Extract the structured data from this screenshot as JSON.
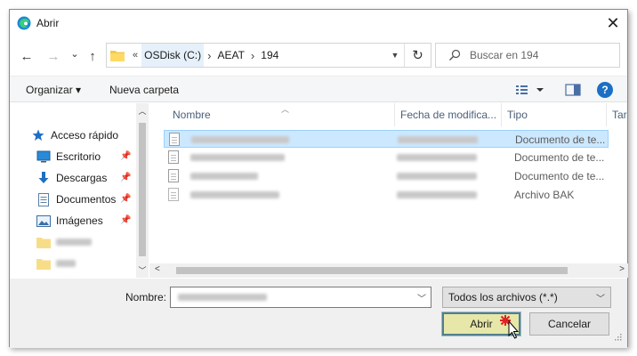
{
  "window": {
    "title": "Abrir",
    "close_symbol": "✕"
  },
  "nav": {
    "back": "←",
    "forward": "→",
    "recent": "⌄",
    "up": "↑"
  },
  "address": {
    "overflow": "«",
    "crumbs": [
      "OSDisk (C:)",
      "AEAT",
      "194"
    ],
    "separator": "›",
    "refresh": "↻"
  },
  "search": {
    "placeholder": "Buscar en 194"
  },
  "toolbar": {
    "organize": "Organizar ▾",
    "new_folder": "Nueva carpeta",
    "help": "?"
  },
  "navpane": {
    "items": [
      {
        "label": "Acceso rápido",
        "icon": "star-icon",
        "pinned": false
      },
      {
        "label": "Escritorio",
        "icon": "desktop-icon",
        "pinned": true
      },
      {
        "label": "Descargas",
        "icon": "download-icon",
        "pinned": true
      },
      {
        "label": "Documentos",
        "icon": "documents-icon",
        "pinned": true
      },
      {
        "label": "Imágenes",
        "icon": "pictures-icon",
        "pinned": true
      }
    ]
  },
  "filelist": {
    "columns": [
      "Nombre",
      "Fecha de modifica...",
      "Tipo",
      "Tar"
    ],
    "rows": [
      {
        "type": "Documento de te...",
        "selected": true
      },
      {
        "type": "Documento de te...",
        "selected": false
      },
      {
        "type": "Documento de te...",
        "selected": false
      },
      {
        "type": "Archivo BAK",
        "selected": false
      }
    ]
  },
  "bottom": {
    "filename_label": "Nombre:",
    "filter": "Todos los archivos (*.*)",
    "open_label": "Abrir",
    "cancel_label": "Cancelar"
  },
  "colors": {
    "accent": "#1c6fc4",
    "selection": "#cce8ff",
    "open_button": "#e7e7a9"
  }
}
